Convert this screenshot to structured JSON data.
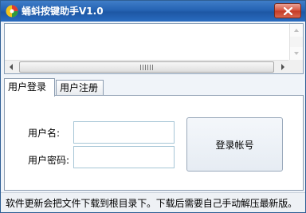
{
  "window": {
    "title": "蛹蚪按键助手V1.0",
    "icon": "app-logo-icon",
    "close_icon": "close-icon"
  },
  "log": {
    "content": ""
  },
  "tabs": [
    {
      "label": "用户登录",
      "active": true
    },
    {
      "label": "用户注册",
      "active": false
    }
  ],
  "login_form": {
    "username_label": "用户名:",
    "username_value": "",
    "password_label": "用户密码:",
    "password_value": "",
    "submit_label": "登录帐号"
  },
  "status": {
    "text": "软件更新会把文件下载到根目录下。下载后需要自己手动解压最新版。"
  },
  "colors": {
    "titlebar": "#2563b3",
    "close_button": "#d5523c",
    "input_border": "#a6c6d6"
  }
}
